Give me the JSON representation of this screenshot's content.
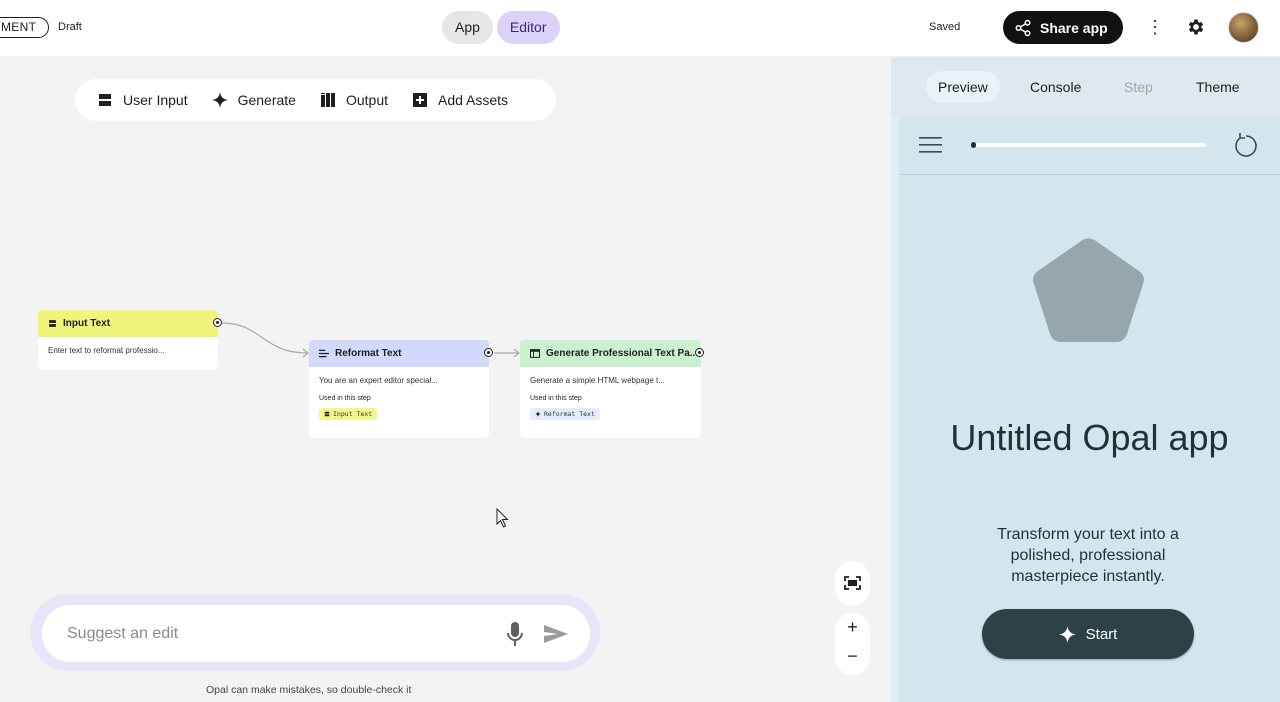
{
  "header": {
    "experiment_label": "MENT",
    "draft_label": "Draft",
    "modes": [
      "App",
      "Editor"
    ],
    "active_mode": "Editor",
    "saved_label": "Saved",
    "share_label": "Share app",
    "kebab_glyph": "⋮"
  },
  "toolbar": {
    "items": [
      {
        "label": "User Input",
        "icon": "user-input-icon"
      },
      {
        "label": "Generate",
        "icon": "sparkle-icon"
      },
      {
        "label": "Output",
        "icon": "output-icon"
      },
      {
        "label": "Add Assets",
        "icon": "add-box-icon"
      }
    ]
  },
  "nodes": {
    "input": {
      "title": "Input Text",
      "desc": "Enter text to reformat professio...",
      "color": "#eff57a"
    },
    "reformat": {
      "title": "Reformat Text",
      "desc": "You are an expert editor special...",
      "used_label": "Used in this step",
      "chip": "Input Text",
      "color": "#d2d9fb"
    },
    "generate": {
      "title": "Generate Professional Text Pa...",
      "desc": "Generate a simple HTML webpage t...",
      "used_label": "Used in this step",
      "chip": "Reformat Text",
      "color": "#c9f1cf"
    }
  },
  "suggest": {
    "placeholder": "Suggest an edit",
    "disclaimer": "Opal can make mistakes, so double-check it"
  },
  "zoom": {
    "plus": "+",
    "minus": "−"
  },
  "panel": {
    "tabs": [
      "Preview",
      "Console",
      "Step",
      "Theme"
    ],
    "active_tab": "Preview",
    "disabled_tab": "Step",
    "app_title": "Untitled Opal app",
    "app_description": "Transform your text into a polished, professional masterpiece instantly.",
    "start_label": "Start",
    "colors": {
      "background": "#d3e5ed",
      "button": "#2c4247",
      "shape": "#95a6ad"
    }
  }
}
